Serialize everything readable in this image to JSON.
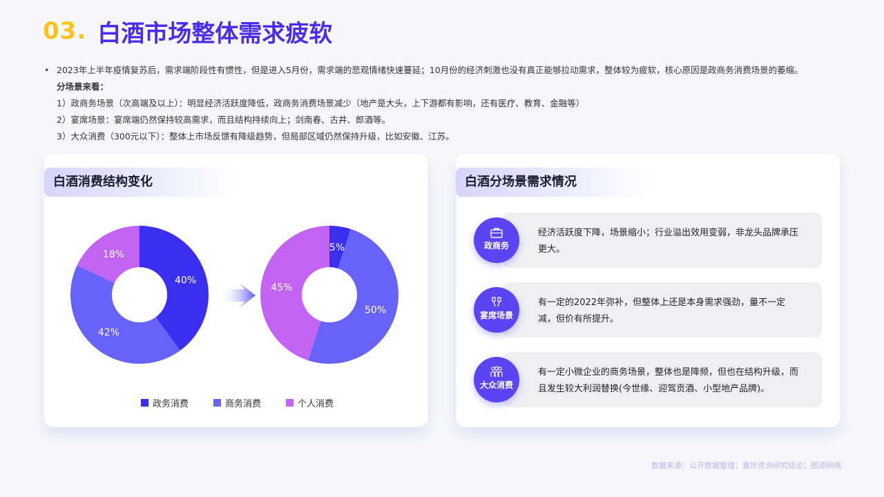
{
  "header": {
    "number": "03.",
    "title": "白酒市场整体需求疲软"
  },
  "intro": {
    "bullet": "•",
    "paragraph": "2023年上半年疫情复苏后，需求端阶段性有惯性，但是进入5月份，需求端的悲观情绪快速蔓延；10月份的经济刺激也没有真正能够拉动需求，整体较为疲软，核心原因是政商务消费场景的萎缩。",
    "subtitle": "分场景来看：",
    "points": [
      "1）政商务场景（次高端及以上）：明显经济活跃度降低，政商务消费场景减少（地产是大头，上下游都有影响，还有医疗、教育、金融等）",
      "2）宴席场景：宴席端仍然保持较高需求，而且结构持续向上；剑南春、古井、郎酒等。",
      "3）大众消费（300元以下）：整体上市场反馈有降级趋势，但局部区域仍然保持升级，比如安徽、江苏。"
    ]
  },
  "left_card": {
    "title": "白酒消费结构变化"
  },
  "right_card": {
    "title": "白酒分场景需求情况",
    "rows": [
      {
        "label": "政商务",
        "icon": "briefcase-icon",
        "desc": "经济活跃度下降，场景缩小；行业溢出效用变弱，非龙头品牌承压更大。"
      },
      {
        "label": "宴席场景",
        "icon": "wine-glasses-icon",
        "desc": "有一定的2022年弥补，但整体上还是本身需求强劲，量不一定减，但价有所提升。"
      },
      {
        "label": "大众消费",
        "icon": "people-icon",
        "desc": "有一定小微企业的商务场景，整体也是降频，但也在结构升级，而且发生较大利润替换(今世缘、迎驾贡酒、小型地产品牌)。"
      }
    ]
  },
  "colors": {
    "accent_number": "#ffc21a",
    "title": "#4a2bf0",
    "icon_circle": "#5a44f4"
  },
  "chart_data": [
    {
      "type": "pie",
      "categories": [
        "政务消费",
        "商务消费",
        "个人消费"
      ],
      "values": [
        40,
        42,
        18
      ],
      "value_labels": [
        "40%",
        "42%",
        "18%"
      ],
      "colors": [
        "#3a2ff0",
        "#6762fa",
        "#c363f4"
      ]
    },
    {
      "type": "pie",
      "categories": [
        "政务消费",
        "商务消费",
        "个人消费"
      ],
      "values": [
        5,
        50,
        45
      ],
      "value_labels": [
        "5%",
        "50%",
        "45%"
      ],
      "colors": [
        "#3a2ff0",
        "#6762fa",
        "#c363f4"
      ]
    }
  ],
  "footer": {
    "source": "数据来源：公开数据整理；嘉世咨询研究结论；图源网络"
  }
}
